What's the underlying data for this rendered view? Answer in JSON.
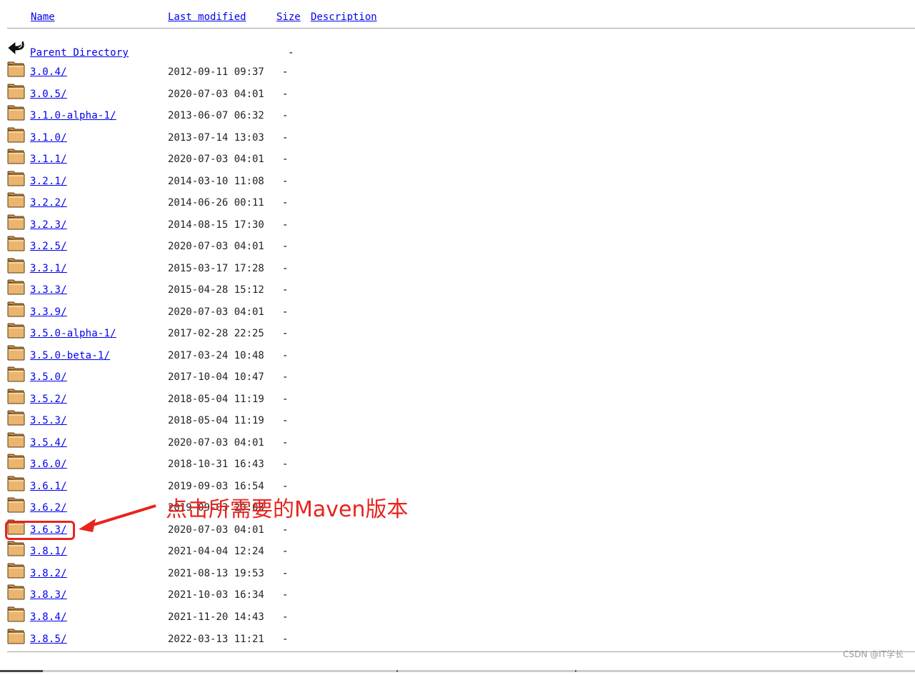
{
  "header": {
    "name": "Name",
    "last_modified": "Last modified",
    "size": "Size",
    "description": "Description"
  },
  "parent": {
    "label": "Parent Directory",
    "size": "-"
  },
  "rows": [
    {
      "name": "3.0.4/",
      "date": "2012-09-11 09:37",
      "size": "-"
    },
    {
      "name": "3.0.5/",
      "date": "2020-07-03 04:01",
      "size": "-"
    },
    {
      "name": "3.1.0-alpha-1/",
      "date": "2013-06-07 06:32",
      "size": "-"
    },
    {
      "name": "3.1.0/",
      "date": "2013-07-14 13:03",
      "size": "-"
    },
    {
      "name": "3.1.1/",
      "date": "2020-07-03 04:01",
      "size": "-"
    },
    {
      "name": "3.2.1/",
      "date": "2014-03-10 11:08",
      "size": "-"
    },
    {
      "name": "3.2.2/",
      "date": "2014-06-26 00:11",
      "size": "-"
    },
    {
      "name": "3.2.3/",
      "date": "2014-08-15 17:30",
      "size": "-"
    },
    {
      "name": "3.2.5/",
      "date": "2020-07-03 04:01",
      "size": "-"
    },
    {
      "name": "3.3.1/",
      "date": "2015-03-17 17:28",
      "size": "-"
    },
    {
      "name": "3.3.3/",
      "date": "2015-04-28 15:12",
      "size": "-"
    },
    {
      "name": "3.3.9/",
      "date": "2020-07-03 04:01",
      "size": "-"
    },
    {
      "name": "3.5.0-alpha-1/",
      "date": "2017-02-28 22:25",
      "size": "-"
    },
    {
      "name": "3.5.0-beta-1/",
      "date": "2017-03-24 10:48",
      "size": "-"
    },
    {
      "name": "3.5.0/",
      "date": "2017-10-04 10:47",
      "size": "-"
    },
    {
      "name": "3.5.2/",
      "date": "2018-05-04 11:19",
      "size": "-"
    },
    {
      "name": "3.5.3/",
      "date": "2018-05-04 11:19",
      "size": "-"
    },
    {
      "name": "3.5.4/",
      "date": "2020-07-03 04:01",
      "size": "-"
    },
    {
      "name": "3.6.0/",
      "date": "2018-10-31 16:43",
      "size": "-"
    },
    {
      "name": "3.6.1/",
      "date": "2019-09-03 16:54",
      "size": "-"
    },
    {
      "name": "3.6.2/",
      "date": "2019-09-03 20:03",
      "size": "-"
    },
    {
      "name": "3.6.3/",
      "date": "2020-07-03 04:01",
      "size": "-"
    },
    {
      "name": "3.8.1/",
      "date": "2021-04-04 12:24",
      "size": "-"
    },
    {
      "name": "3.8.2/",
      "date": "2021-08-13 19:53",
      "size": "-"
    },
    {
      "name": "3.8.3/",
      "date": "2021-10-03 16:34",
      "size": "-"
    },
    {
      "name": "3.8.4/",
      "date": "2021-11-20 14:43",
      "size": "-"
    },
    {
      "name": "3.8.5/",
      "date": "2022-03-13 11:21",
      "size": "-"
    }
  ],
  "annotation": {
    "text": "点击所需要的Maven版本",
    "color": "#e8231d"
  },
  "watermark": "CSDN @IT学长",
  "colors": {
    "link": "#0000ee",
    "folder": "#e8b06a",
    "annotation": "#e8231d"
  },
  "icons": {
    "parent": "back-arrow-icon",
    "folder": "folder-icon"
  }
}
